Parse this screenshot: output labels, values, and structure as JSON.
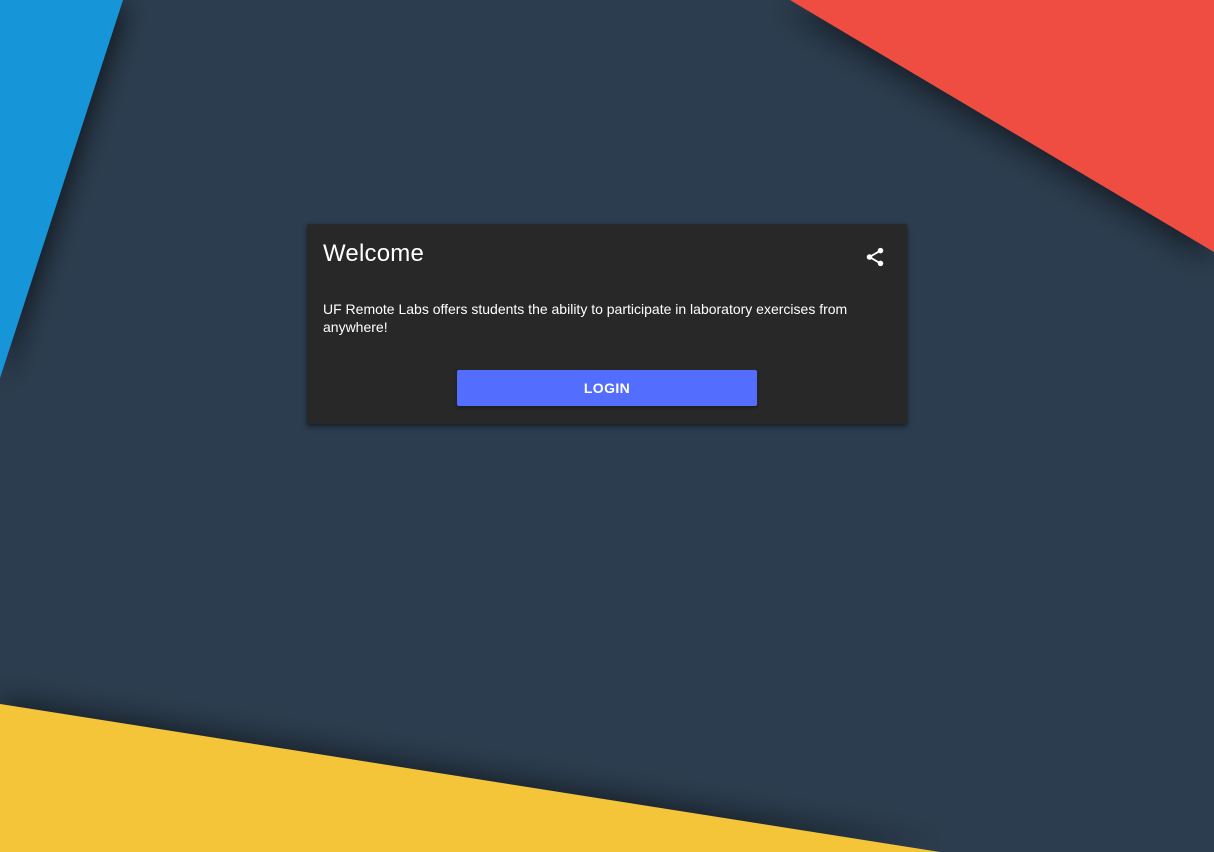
{
  "colors": {
    "background": "#2c3d4f",
    "blue_shape": "#1796d8",
    "red_shape": "#f04d43",
    "yellow_shape": "#f4c537",
    "card_bg": "#282828",
    "button_bg": "#536dfe",
    "text": "#ffffff"
  },
  "card": {
    "title": "Welcome",
    "description": "UF Remote Labs offers students the ability to participate in laboratory exercises from anywhere!",
    "share_icon": "share-icon",
    "login_label": "LOGIN"
  }
}
